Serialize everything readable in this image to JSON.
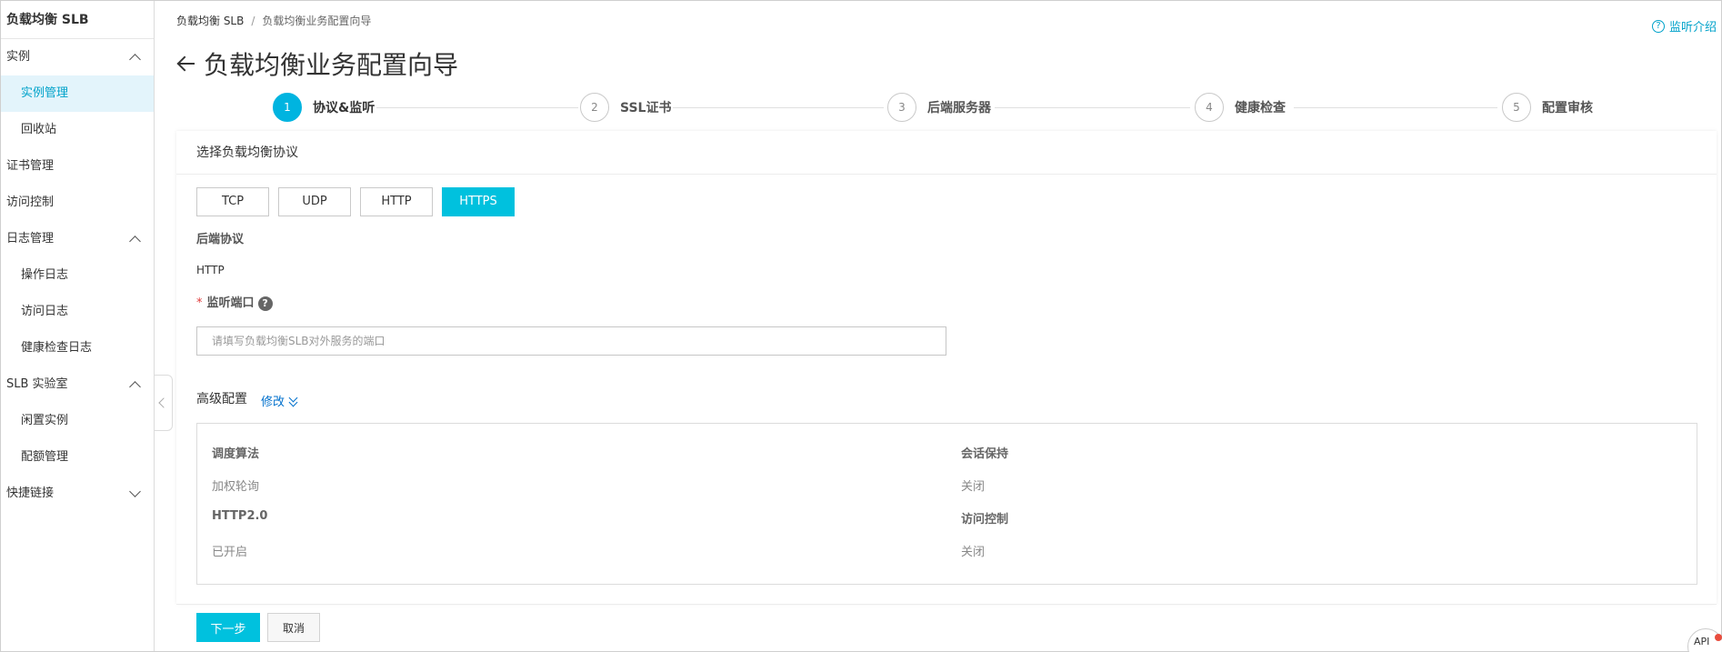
{
  "sidebar": {
    "title": "负载均衡 SLB",
    "groups": [
      {
        "label": "实例"
      },
      {
        "label": "证书管理"
      },
      {
        "label": "访问控制"
      },
      {
        "label": "日志管理"
      },
      {
        "label": "SLB 实验室"
      },
      {
        "label": "快捷链接"
      }
    ],
    "items": {
      "instance_manage": "实例管理",
      "recycle": "回收站",
      "op_log": "操作日志",
      "access_log": "访问日志",
      "health_log": "健康检查日志",
      "idle_instance": "闲置实例",
      "quota_manage": "配额管理"
    }
  },
  "breadcrumb": {
    "root": "负载均衡 SLB",
    "sep": "/",
    "current": "负载均衡业务配置向导"
  },
  "help": {
    "icon_text": "?",
    "label": "监听介绍"
  },
  "page_title": "负载均衡业务配置向导",
  "steps": [
    {
      "num": "1",
      "label": "协议&监听",
      "active": true
    },
    {
      "num": "2",
      "label": "SSL证书"
    },
    {
      "num": "3",
      "label": "后端服务器"
    },
    {
      "num": "4",
      "label": "健康检查"
    },
    {
      "num": "5",
      "label": "配置审核"
    }
  ],
  "protocol": {
    "heading": "选择负载均衡协议",
    "options": [
      "TCP",
      "UDP",
      "HTTP",
      "HTTPS"
    ],
    "selected": "HTTPS"
  },
  "backend": {
    "label": "后端协议",
    "value": "HTTP"
  },
  "port": {
    "required_mark": "*",
    "label": "监听端口",
    "help_icon": "?",
    "placeholder": "请填写负载均衡SLB对外服务的端口"
  },
  "advanced": {
    "title": "高级配置",
    "edit_label": "修改",
    "scheduler_label": "调度算法",
    "scheduler_value": "加权轮询",
    "session_label": "会话保持",
    "session_value": "关闭",
    "http2_label": "HTTP2.0",
    "http2_value": "已开启",
    "acl_label": "访问控制",
    "acl_value": "关闭"
  },
  "footer": {
    "next_label": "下一步",
    "cancel_label": "取消"
  },
  "api_badge": "API",
  "colors": {
    "accent": "#00c1de",
    "step_active": "#00b4e0",
    "link": "#0070cc",
    "sidebar_active_bg": "#e3f4fb",
    "required": "#e03c3c"
  }
}
